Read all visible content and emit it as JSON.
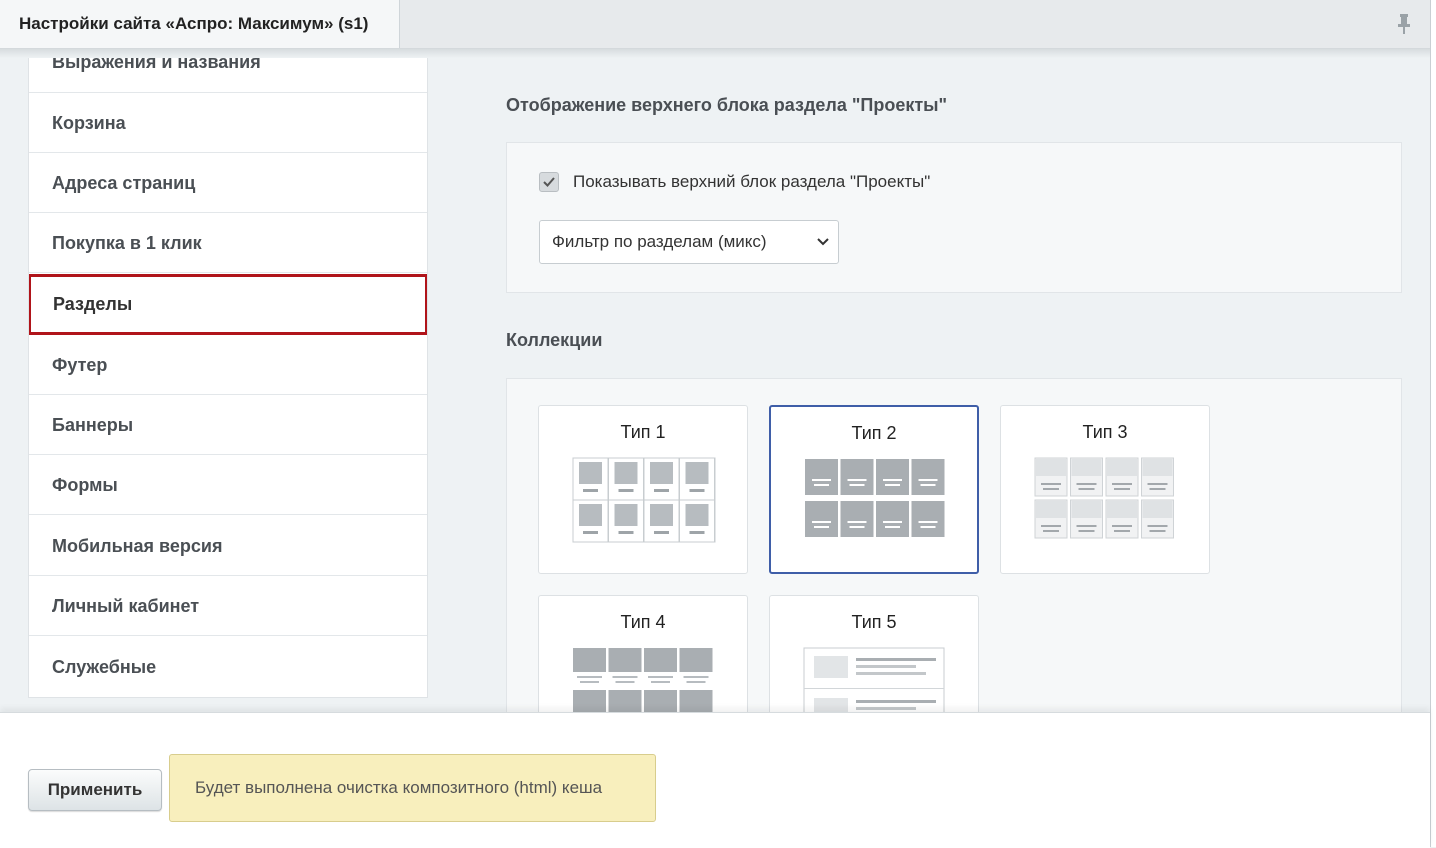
{
  "window": {
    "tab_title": "Настройки сайта «Аспро: Максимум» (s1)",
    "pin_icon": "pin-icon"
  },
  "sidebar": {
    "items": [
      {
        "label": "Выражения и названия"
      },
      {
        "label": "Корзина"
      },
      {
        "label": "Адреса страниц"
      },
      {
        "label": "Покупка в 1 клик"
      },
      {
        "label": "Разделы",
        "active": true
      },
      {
        "label": "Футер"
      },
      {
        "label": "Баннеры"
      },
      {
        "label": "Формы"
      },
      {
        "label": "Мобильная версия"
      },
      {
        "label": "Личный кабинет"
      },
      {
        "label": "Служебные"
      }
    ]
  },
  "main": {
    "top_block": {
      "title": "Отображение верхнего блока раздела \"Проекты\"",
      "checkbox_label": "Показывать верхний блок раздела \"Проекты\"",
      "checkbox_checked": true,
      "select_value": "Фильтр по разделам (микс)"
    },
    "collections": {
      "title": "Коллекции",
      "types": [
        {
          "label": "Тип 1",
          "selected": false
        },
        {
          "label": "Тип 2",
          "selected": true
        },
        {
          "label": "Тип 3",
          "selected": false
        },
        {
          "label": "Тип 4",
          "selected": false
        },
        {
          "label": "Тип 5",
          "selected": false
        }
      ]
    }
  },
  "footer": {
    "apply_label": "Применить",
    "notice": "Будет выполнена очистка композитного (html) кеша"
  },
  "colors": {
    "active_border": "#b0141a",
    "selected_card_border": "#3f5ea8",
    "notice_bg": "#f8efbd"
  }
}
